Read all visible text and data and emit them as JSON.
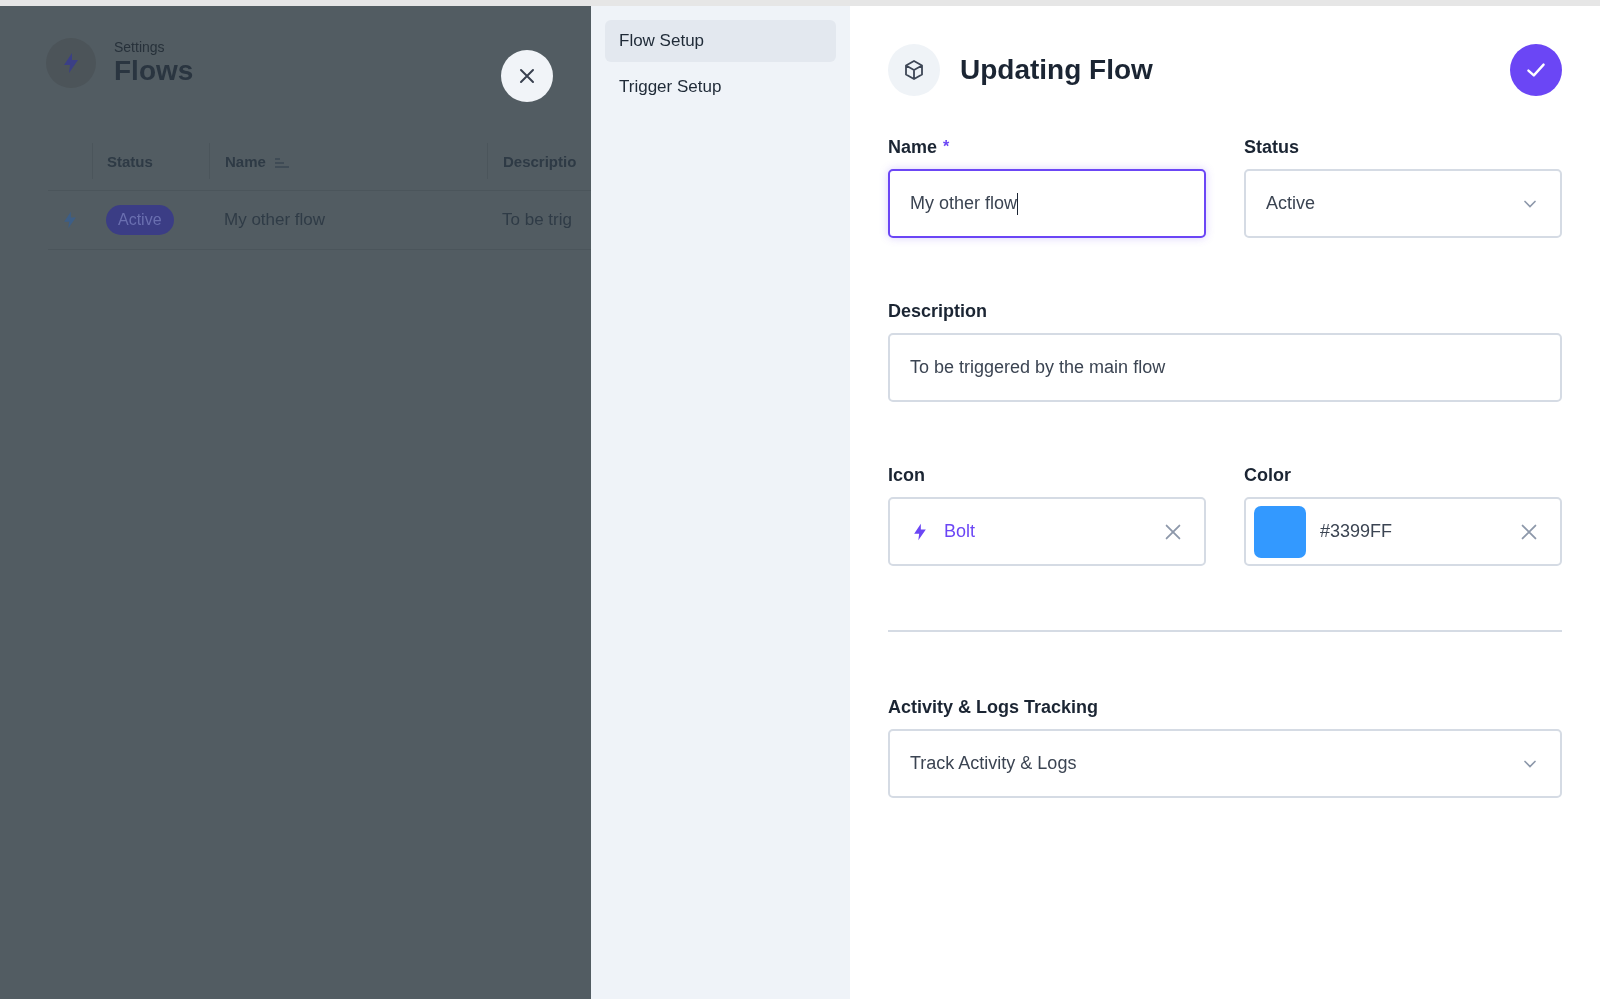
{
  "background_page": {
    "breadcrumb": "Settings",
    "title": "Flows",
    "table": {
      "columns": [
        "Status",
        "Name",
        "Descriptio"
      ],
      "rows": [
        {
          "status": "Active",
          "name": "My other flow",
          "description": "To be trig"
        }
      ]
    }
  },
  "sidebar": {
    "items": [
      {
        "label": "Flow Setup",
        "selected": true
      },
      {
        "label": "Trigger Setup",
        "selected": false
      }
    ]
  },
  "form": {
    "title": "Updating Flow",
    "rows": [
      {
        "kind": "fields",
        "fields": [
          {
            "kind": "text",
            "label": "Name",
            "label_mark": "*",
            "value": "My other flow",
            "focused": true
          },
          {
            "kind": "select",
            "label": "Status",
            "value": "Active",
            "focused": false
          }
        ]
      },
      {
        "kind": "fields",
        "fields": [
          {
            "kind": "text",
            "label": "Description",
            "value": "To be triggered by the main flow",
            "focused": false
          }
        ]
      },
      {
        "kind": "fields",
        "fields": [
          {
            "kind": "icon",
            "label": "Icon",
            "value": "Bolt",
            "focused": false
          },
          {
            "kind": "color",
            "label": "Color",
            "value": "#3399FF",
            "color": "#3399ff",
            "focused": false
          }
        ]
      },
      {
        "kind": "divider"
      },
      {
        "kind": "fields",
        "fields": [
          {
            "kind": "select",
            "label": "Activity & Logs Tracking",
            "value": "Track Activity & Logs",
            "focused": false
          }
        ]
      }
    ]
  }
}
